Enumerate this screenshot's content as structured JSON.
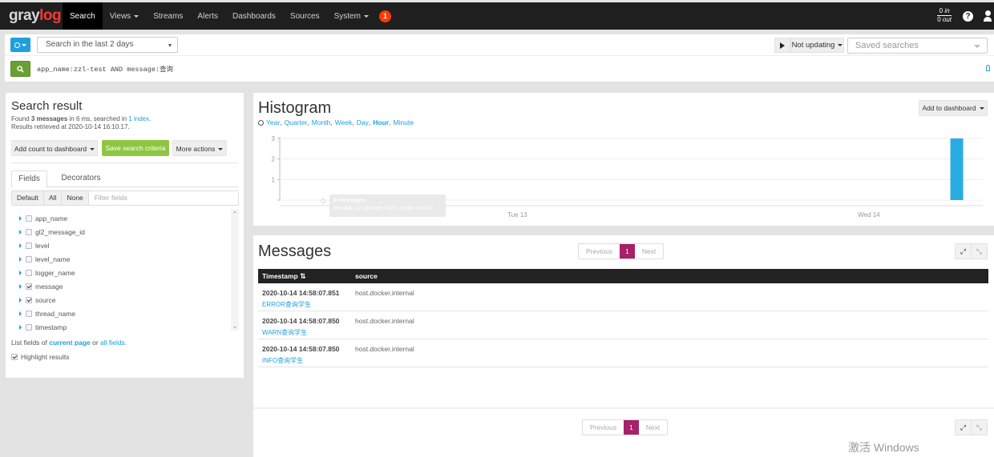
{
  "navbar": {
    "logo_part1": "gray",
    "logo_part2": "log",
    "items": [
      {
        "label": "Search",
        "active": true,
        "caret": false
      },
      {
        "label": "Views",
        "active": false,
        "caret": true
      },
      {
        "label": "Streams",
        "active": false,
        "caret": false
      },
      {
        "label": "Alerts",
        "active": false,
        "caret": false
      },
      {
        "label": "Dashboards",
        "active": false,
        "caret": false
      },
      {
        "label": "Sources",
        "active": false,
        "caret": false
      },
      {
        "label": "System",
        "active": false,
        "caret": true
      }
    ],
    "notification_count": "1",
    "throughput_in": "0",
    "throughput_in_unit": "in",
    "throughput_out": "0",
    "throughput_out_unit": "out",
    "help_icon": "?"
  },
  "search": {
    "time_range": "Search in the last 2 days",
    "refresh_label": "Not updating",
    "saved_searches_placeholder": "Saved searches",
    "query": "app_name:zzl-test AND message:查询"
  },
  "search_result": {
    "title": "Search result",
    "found_prefix": "Found ",
    "found_count": "3 messages",
    "found_mid": " in 6 ms, searched in ",
    "index_link": "1 index",
    "found_suffix": ".",
    "retrieved": "Results retrieved at 2020-10-14 16:10:17.",
    "add_count_label": "Add count to dashboard",
    "save_criteria_label": "Save search criteria",
    "more_actions_label": "More actions"
  },
  "fields_panel": {
    "tabs": [
      "Fields",
      "Decorators"
    ],
    "filter_buttons": [
      "Default",
      "All",
      "None"
    ],
    "filter_placeholder": "Filter fields",
    "fields": [
      {
        "name": "app_name",
        "checked": false
      },
      {
        "name": "gl2_message_id",
        "checked": false
      },
      {
        "name": "level",
        "checked": false
      },
      {
        "name": "level_name",
        "checked": false
      },
      {
        "name": "logger_name",
        "checked": false
      },
      {
        "name": "message",
        "checked": true
      },
      {
        "name": "source",
        "checked": true
      },
      {
        "name": "thread_name",
        "checked": false
      },
      {
        "name": "timestamp",
        "checked": false
      }
    ],
    "list_prefix": "List fields of ",
    "current_page": "current page",
    "list_mid": " or ",
    "all_fields": "all fields",
    "list_suffix": ".",
    "highlight_label": "Highlight results",
    "highlight_checked": true
  },
  "histogram": {
    "title": "Histogram",
    "resolutions": [
      "Year",
      "Quarter",
      "Month",
      "Week",
      "Day",
      "Hour",
      "Minute"
    ],
    "active_resolution": "Hour",
    "add_to_dashboard_label": "Add to dashboard",
    "tooltip_line1": "0 messages",
    "tooltip_line2": "Monday 12 October 2020, 19:00 +08:00"
  },
  "chart_data": {
    "type": "bar",
    "title": "Histogram",
    "xlabel": "",
    "ylabel": "",
    "ylim": [
      0,
      3
    ],
    "yticks": [
      1,
      2,
      3
    ],
    "xtick_labels": [
      {
        "label": "Tue 13",
        "position_fraction": 0.338
      },
      {
        "label": "Wed 14",
        "position_fraction": 0.838
      }
    ],
    "x_domain_hours": 48,
    "series": [
      {
        "name": "messages",
        "color": "#2aace2",
        "values": [
          {
            "x_fraction": 0.963,
            "value": 3
          }
        ]
      }
    ],
    "grid": true
  },
  "messages": {
    "title": "Messages",
    "pagination": {
      "previous": "Previous",
      "current": "1",
      "next": "Next"
    },
    "columns": [
      "Timestamp",
      "source"
    ],
    "rows": [
      {
        "timestamp": "2020-10-14 14:58:07.851",
        "source": "host.docker.internal",
        "message": "ERROR查询学生"
      },
      {
        "timestamp": "2020-10-14 14:58:07.850",
        "source": "host.docker.internal",
        "message": "WARN查询学生"
      },
      {
        "timestamp": "2020-10-14 14:58:07.850",
        "source": "host.docker.internal",
        "message": "INFO查询学生"
      }
    ]
  },
  "watermark": "激活 Windows",
  "colors": {
    "accent": "#1ea0db",
    "navbar": "#1f1f1f",
    "success": "#8dc63f",
    "pager_active": "#a6206a",
    "bar": "#2aace2"
  }
}
